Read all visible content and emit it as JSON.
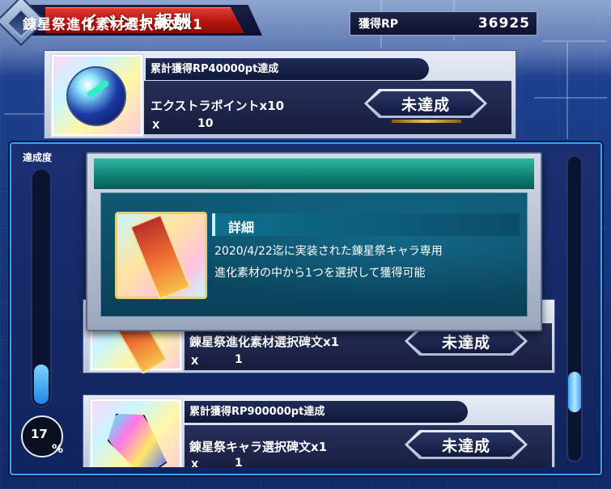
{
  "header": {
    "title": "イベント報酬",
    "rp_label": "獲得RP",
    "rp_value": "36925"
  },
  "rewards_top": {
    "condition": "累計獲得RP40000pt達成",
    "item_name": "エクストラポイントx10",
    "qty_x": "X",
    "qty": "10",
    "status": "未達成"
  },
  "progress": {
    "label": "達成度",
    "value": "17",
    "unit": "%",
    "fraction": 0.17
  },
  "list": {
    "items": [
      {
        "item_name": "錬星祭進化素材選択碑文x1",
        "qty_x": "X",
        "qty": "1",
        "status": "未達成"
      },
      {
        "condition": "累計獲得RP900000pt達成",
        "item_name": "錬星祭キャラ選択碑文x1",
        "qty_x": "X",
        "qty": "1",
        "status": "未達成"
      }
    ]
  },
  "popup": {
    "title": "錬星祭進化素材選択碑文x1",
    "detail_heading": "詳細",
    "detail_line_1": "2020/4/22迄に実装された錬星祭キャラ専用",
    "detail_line_2": "進化素材の中から1つを選択して獲得可能"
  },
  "colors": {
    "accent_red": "#b3140f",
    "panel_blue": "#1b2f72",
    "popup_teal": "#0f7d72",
    "progress_blue": "#1e86e6"
  },
  "icons": {
    "top_item": "orb-with-key-icon",
    "popup_item": "inscription-ticket-icon",
    "list_item_1": "inscription-ticket-icon",
    "list_item_2": "crystal-inscription-icon"
  }
}
